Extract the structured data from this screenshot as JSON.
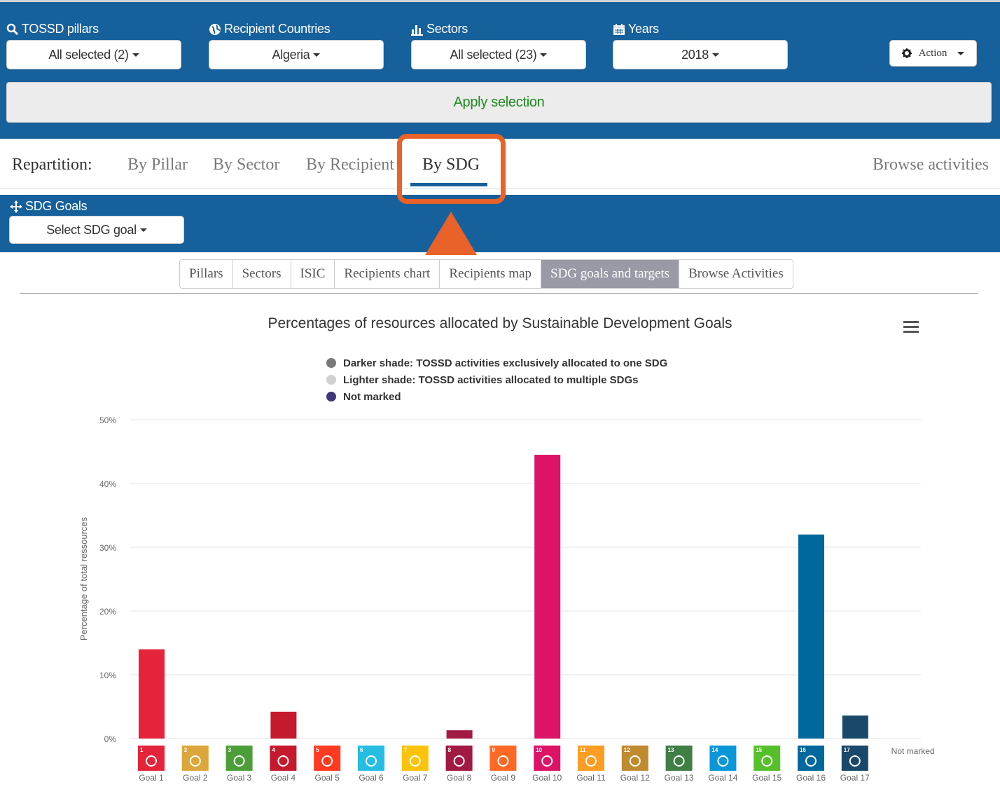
{
  "filters": [
    {
      "label": "TOSSD pillars",
      "value": "All selected (2)",
      "icon": "search-icon"
    },
    {
      "label": "Recipient Countries",
      "value": "Algeria",
      "icon": "globe-icon"
    },
    {
      "label": "Sectors",
      "value": "All selected (23)",
      "icon": "bar-chart-icon"
    },
    {
      "label": "Years",
      "value": "2018",
      "icon": "calendar-icon"
    }
  ],
  "action": {
    "label": "Action",
    "icon": "gear-icon"
  },
  "apply": {
    "label": "Apply selection"
  },
  "repartition": {
    "label": "Repartition:",
    "tabs": [
      "By Pillar",
      "By Sector",
      "By Recipient",
      "By SDG"
    ],
    "active": "By SDG",
    "browse": "Browse activities"
  },
  "sdg_filter": {
    "label": "SDG Goals",
    "value": "Select SDG goal",
    "icon": "move-icon"
  },
  "view_tabs": [
    "Pillars",
    "Sectors",
    "ISIC",
    "Recipients chart",
    "Recipients map",
    "SDG goals and targets",
    "Browse Activities"
  ],
  "view_tab_active": "SDG goals and targets",
  "colors": {
    "header_bg": "#16609b",
    "apply_text": "#1d8a1d",
    "highlight": "#e8622a"
  },
  "chart_data": {
    "type": "bar",
    "title": "Percentages of resources allocated by Sustainable Development Goals",
    "legend": [
      {
        "label": "Darker shade: TOSSD activities exclusively allocated to one SDG",
        "color": "#7a7a7a"
      },
      {
        "label": "Lighter shade: TOSSD activities allocated to multiple SDGs",
        "color": "#d0d0d0"
      },
      {
        "label": "Not marked",
        "color": "#3d3a7a"
      }
    ],
    "legend_position": "top-center",
    "ylabel": "Percentage of total ressources",
    "ylim": [
      0,
      50
    ],
    "yticks": [
      "0%",
      "10%",
      "20%",
      "30%",
      "40%",
      "50%"
    ],
    "grid": true,
    "categories": [
      "Goal 1",
      "Goal 2",
      "Goal 3",
      "Goal 4",
      "Goal 5",
      "Goal 6",
      "Goal 7",
      "Goal 8",
      "Goal 9",
      "Goal 10",
      "Goal 11",
      "Goal 12",
      "Goal 13",
      "Goal 14",
      "Goal 15",
      "Goal 16",
      "Goal 17",
      "Not marked"
    ],
    "values": [
      14,
      0,
      0,
      4.2,
      0,
      0,
      0,
      1.3,
      0,
      44.5,
      0,
      0,
      0,
      0,
      0,
      32,
      3.6,
      0
    ],
    "colors": [
      "#e5243b",
      "#dda63a",
      "#4c9f38",
      "#c5192d",
      "#ff3a21",
      "#26bde2",
      "#fcc30b",
      "#a21942",
      "#fd6925",
      "#dd1367",
      "#fd9d24",
      "#bf8b2e",
      "#3f7e44",
      "#0a97d9",
      "#56c02b",
      "#00689d",
      "#19486a",
      "#3d3a7a"
    ]
  }
}
